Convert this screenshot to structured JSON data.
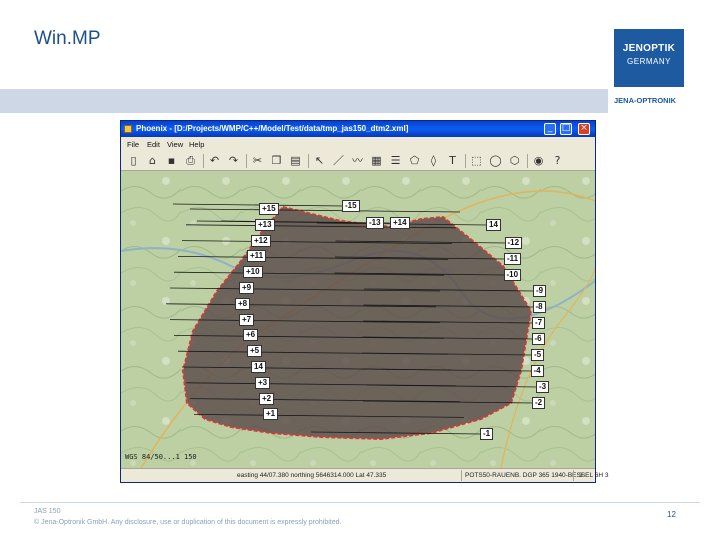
{
  "slide": {
    "title": "Win.MP",
    "page_number": "12",
    "footer_line1": "JAS 150",
    "footer_line2": "© Jena-Optronik GmbH. Any disclosure, use or duplication of this document is expressly prohibited."
  },
  "logo": {
    "line1": "JENOPTIK",
    "line2": "GERMANY",
    "subline": "JENA-OPTRONIK"
  },
  "window": {
    "title": "Phoenix - [D:/Projects/WMP/C++/Model/Test/data/tmp_jas150_dtm2.xml]",
    "min_label": "_",
    "max_label": "□",
    "close_label": "×",
    "menu": [
      "File",
      "Edit",
      "View",
      "Help"
    ],
    "toolbar_icons": [
      "new-file-icon",
      "open-folder-icon",
      "save-icon",
      "print-icon",
      "undo-icon",
      "redo-icon",
      "cut-icon",
      "copy-icon",
      "paste-icon",
      "pointer-icon",
      "line-icon",
      "polyline-icon",
      "hatch-icon",
      "lines-icon",
      "polygon-icon",
      "freeform-icon",
      "text-tool-icon",
      "select-rect-icon",
      "circle-icon",
      "hexagon-icon",
      "eye-icon",
      "help-icon"
    ],
    "toolbar_glyphs": [
      "▯",
      "⌂",
      "▪",
      "⎙",
      "↶",
      "↷",
      "✂",
      "❐",
      "▤",
      "↖",
      "／",
      "〰",
      "▦",
      "☰",
      "⬠",
      "◊",
      "T",
      "⬚",
      "◯",
      "⬡",
      "◉",
      "?"
    ],
    "map_scale": "WGS 84/50...1 150",
    "status": {
      "easting": "easting 44/07.380 northing 5646314.000 Lat 47.335",
      "crs": "POTS50-RAUENB. DGP 365 1940-BESSEL 6H 3",
      "page": "3"
    }
  },
  "strip_labels": {
    "left": [
      "+15",
      "+13",
      "+12",
      "+11",
      "+10",
      "+9",
      "+8",
      "+7",
      "+6",
      "+5",
      "14",
      "+3",
      "+2",
      "+1"
    ],
    "right": [
      "-15",
      "-13",
      "+14",
      "14",
      "-12",
      "-11",
      "-10",
      "-9",
      "-8",
      "-7",
      "-6",
      "-5",
      "-4",
      "-3",
      "-2",
      "-1"
    ]
  },
  "colors": {
    "title_blue": "#1c4f8c",
    "band": "#cdd7e6",
    "logo_blue": "#1d5aa0",
    "map_green": "#b7cc9e",
    "coverage_fill": "#5a4a4a",
    "boundary_red": "#d23a3a"
  }
}
